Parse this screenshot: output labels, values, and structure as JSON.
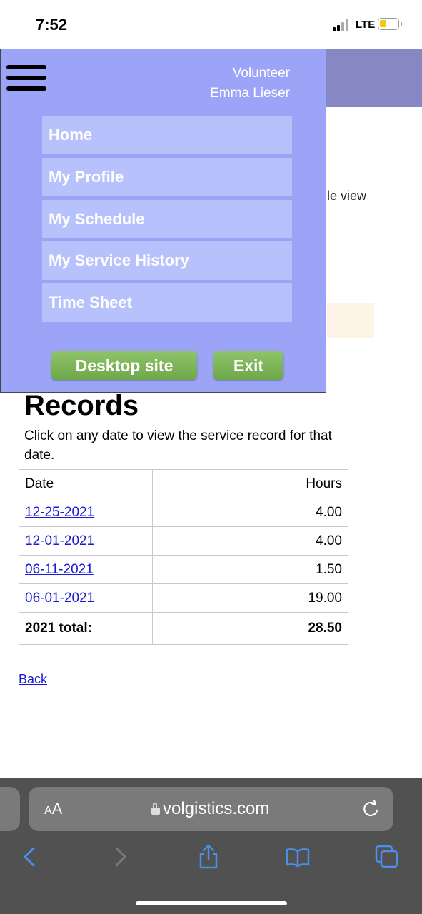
{
  "status_bar": {
    "time": "7:52",
    "network": "LTE"
  },
  "background_page": {
    "partial_text": "le view"
  },
  "menu": {
    "role": "Volunteer",
    "name": "Emma Lieser",
    "items": [
      {
        "label": "Home"
      },
      {
        "label": "My Profile"
      },
      {
        "label": "My Schedule"
      },
      {
        "label": "My Service History"
      },
      {
        "label": "Time Sheet"
      }
    ],
    "desktop_button": "Desktop site",
    "exit_button": "Exit"
  },
  "records": {
    "title": "Records",
    "description": "Click on any date to view the service record for that date.",
    "table": {
      "headers": [
        "Date",
        "Hours"
      ],
      "rows": [
        {
          "date": "12-25-2021",
          "hours": "4.00"
        },
        {
          "date": "12-01-2021",
          "hours": "4.00"
        },
        {
          "date": "06-11-2021",
          "hours": "1.50"
        },
        {
          "date": "06-01-2021",
          "hours": "19.00"
        }
      ],
      "total_label": "2021 total:",
      "total_value": "28.50"
    },
    "back_link": "Back"
  },
  "browser": {
    "text_size_label": "AA",
    "url": "volgistics.com",
    "icons": [
      "lock-icon",
      "reload-icon",
      "back-arrow-icon",
      "forward-arrow-icon",
      "share-icon",
      "bookmarks-icon",
      "tabs-icon"
    ]
  }
}
